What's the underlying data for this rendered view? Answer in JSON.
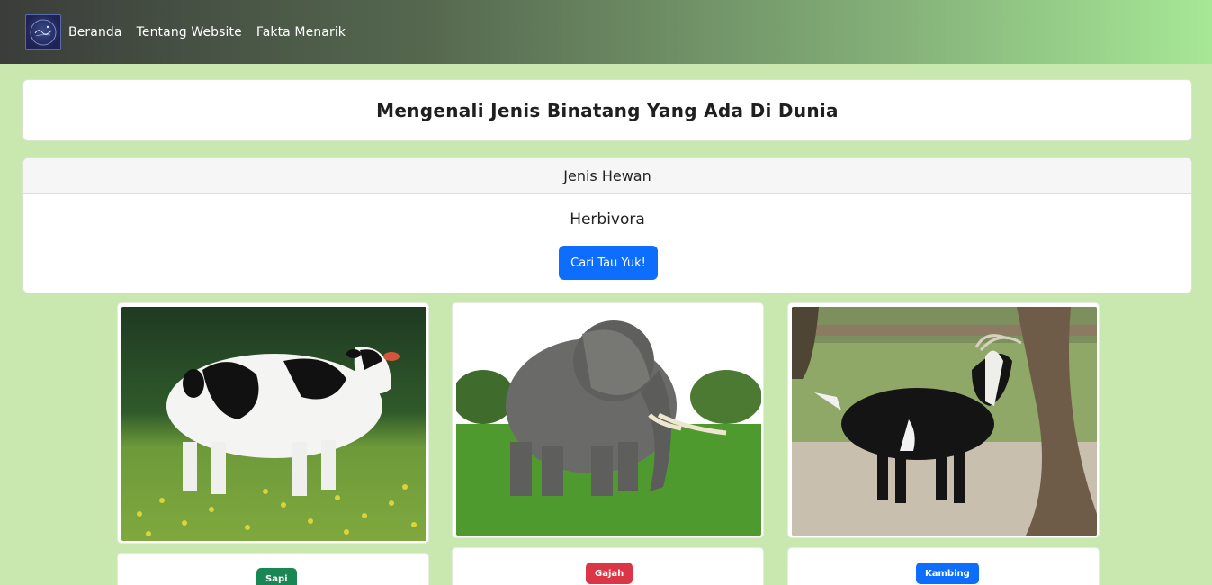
{
  "navbar": {
    "links": [
      "Beranda",
      "Tentang Website",
      "Fakta Menarik"
    ]
  },
  "header": {
    "title": "Mengenali Jenis Binatang Yang Ada Di Dunia"
  },
  "category": {
    "header": "Jenis Hewan",
    "title": "Herbivora",
    "button_label": "Cari Tau Yuk!"
  },
  "animals": [
    {
      "name": "Sapi",
      "badge_color": "#198754"
    },
    {
      "name": "Gajah",
      "badge_color": "#dc3545"
    },
    {
      "name": "Kambing",
      "badge_color": "#0d6efd"
    }
  ],
  "colors": {
    "page_background": "#c8e8b0",
    "primary": "#0d6efd"
  }
}
